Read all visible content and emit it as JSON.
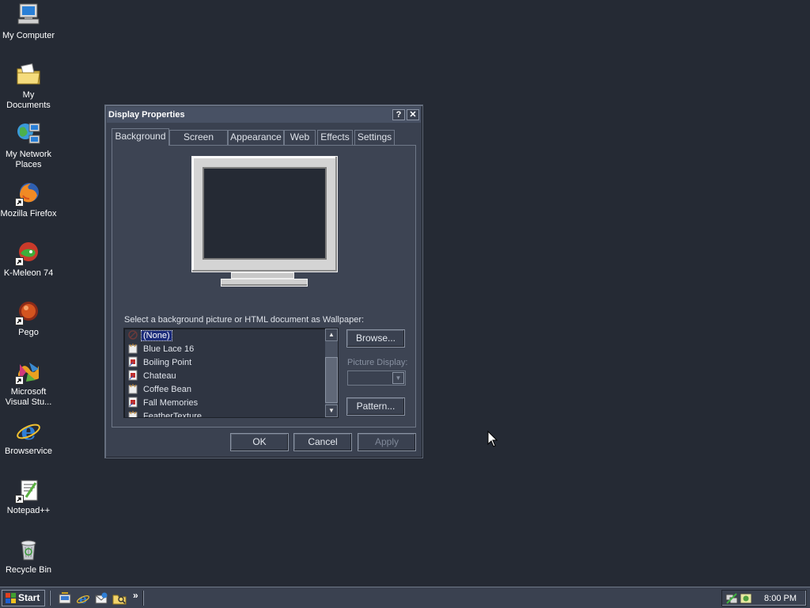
{
  "desktop": {
    "icons": [
      {
        "label": "My Computer",
        "icon": "my-computer-icon"
      },
      {
        "label": "My Documents",
        "icon": "my-documents-icon"
      },
      {
        "label": "My Network Places",
        "icon": "network-places-icon"
      },
      {
        "label": "Mozilla Firefox",
        "icon": "firefox-icon"
      },
      {
        "label": "K-Meleon 74",
        "icon": "k-meleon-icon"
      },
      {
        "label": "Pego",
        "icon": "pego-icon"
      },
      {
        "label": "Microsoft Visual Stu...",
        "icon": "visual-studio-icon"
      },
      {
        "label": "Browservice",
        "icon": "internet-explorer-icon"
      },
      {
        "label": "Notepad++",
        "icon": "notepad-plus-plus-icon"
      },
      {
        "label": "Recycle Bin",
        "icon": "recycle-bin-icon"
      }
    ]
  },
  "dialog": {
    "title": "Display Properties",
    "help_btn": "?",
    "close_btn": "✕",
    "tabs": [
      "Background",
      "Screen Saver",
      "Appearance",
      "Web",
      "Effects",
      "Settings"
    ],
    "active_tab": "Background",
    "wallpaper_label": "Select a background picture or HTML document as Wallpaper:",
    "wallpapers": [
      "(None)",
      "Blue Lace 16",
      "Boiling Point",
      "Chateau",
      "Coffee Bean",
      "Fall Memories",
      "FeatherTexture"
    ],
    "selected_wallpaper": "(None)",
    "browse_btn": "Browse...",
    "picture_display_label": "Picture Display:",
    "picture_display_value": "",
    "pattern_btn": "Pattern...",
    "ok_btn": "OK",
    "cancel_btn": "Cancel",
    "apply_btn": "Apply"
  },
  "taskbar": {
    "start_label": "Start",
    "quick_launch": [
      "show-desktop-icon",
      "internet-explorer-icon",
      "outlook-express-icon",
      "windows-explorer-icon"
    ],
    "overflow": "»",
    "clock": "8:00 PM"
  },
  "colors": {
    "desktop_bg": "#252a34",
    "window_bg": "#3a4150",
    "selection": "#1c2c7a"
  }
}
